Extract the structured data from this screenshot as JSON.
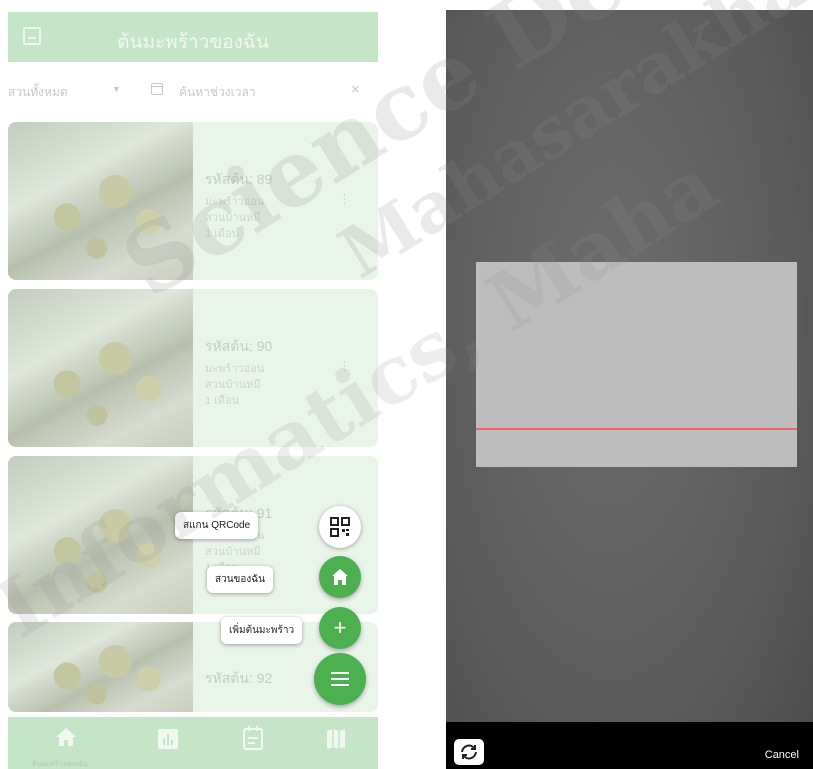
{
  "left_screen": {
    "app_bar": {
      "title": "ต้นมะพร้าวของฉัน",
      "leading_icon": "image-icon"
    },
    "filters": {
      "garden_select": "สวนทั้งหมด",
      "date_search_placeholder": "ค้นหาช่วงเวลา",
      "clear_icon": "×"
    },
    "trees": [
      {
        "id_label": "รหัสต้น: 89",
        "variety": "มะพร้าวอ่อน",
        "garden": "สวนบ้านหมี",
        "age": "1 เดือน"
      },
      {
        "id_label": "รหัสต้น: 90",
        "variety": "มะพร้าวอ่อน",
        "garden": "สวนบ้านหมี",
        "age": "1 เดือน"
      },
      {
        "id_label": "รหัสต้น: 91",
        "variety": "มะพร้าวอ่อน",
        "garden": "สวนบ้านหมี",
        "age": "1 เดือน"
      },
      {
        "id_label": "รหัสต้น: 92",
        "variety": "",
        "garden": "",
        "age": ""
      }
    ],
    "fab_menu": {
      "scan_label": "สแกน QRCode",
      "my_garden_label": "สวนของฉัน",
      "add_tree_label": "เพิ่มต้นมะพร้าว"
    },
    "bottom_nav": {
      "home_label": "ต้นมะพร้าวของฉัน"
    }
  },
  "right_screen": {
    "cancel_label": "Cancel",
    "scan_line_color": "#f06565"
  },
  "watermark": {
    "line1": "Science De",
    "line2": "Mahasarakhan",
    "line3": "Informatics, Maha"
  }
}
